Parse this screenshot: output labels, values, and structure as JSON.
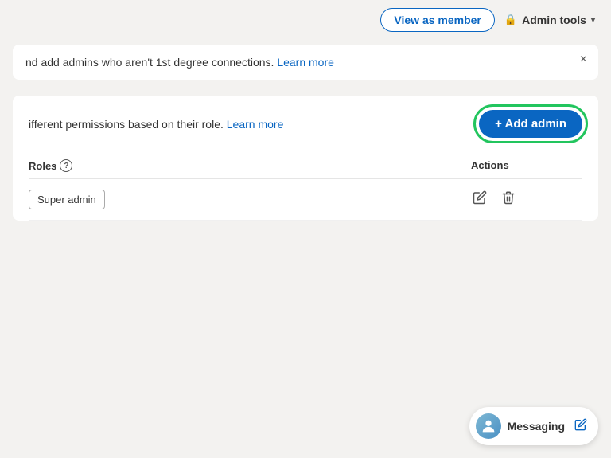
{
  "header": {
    "view_as_member_label": "View as member",
    "admin_tools_label": "Admin tools"
  },
  "notice": {
    "text": "nd add admins who aren't 1st degree connections.",
    "learn_more_label": "Learn more",
    "close_label": "×"
  },
  "admin_section": {
    "description": "ifferent permissions based on their role.",
    "learn_more_label": "Learn more",
    "add_admin_label": "+ Add admin",
    "table": {
      "roles_header": "Roles",
      "actions_header": "Actions",
      "rows": [
        {
          "role": "Super admin"
        }
      ]
    }
  },
  "messaging": {
    "label": "Messaging",
    "edit_icon": "✏"
  },
  "icons": {
    "lock": "🔒",
    "chevron_down": "▾",
    "close": "×",
    "pencil": "✎",
    "trash": "🗑",
    "help": "?"
  }
}
